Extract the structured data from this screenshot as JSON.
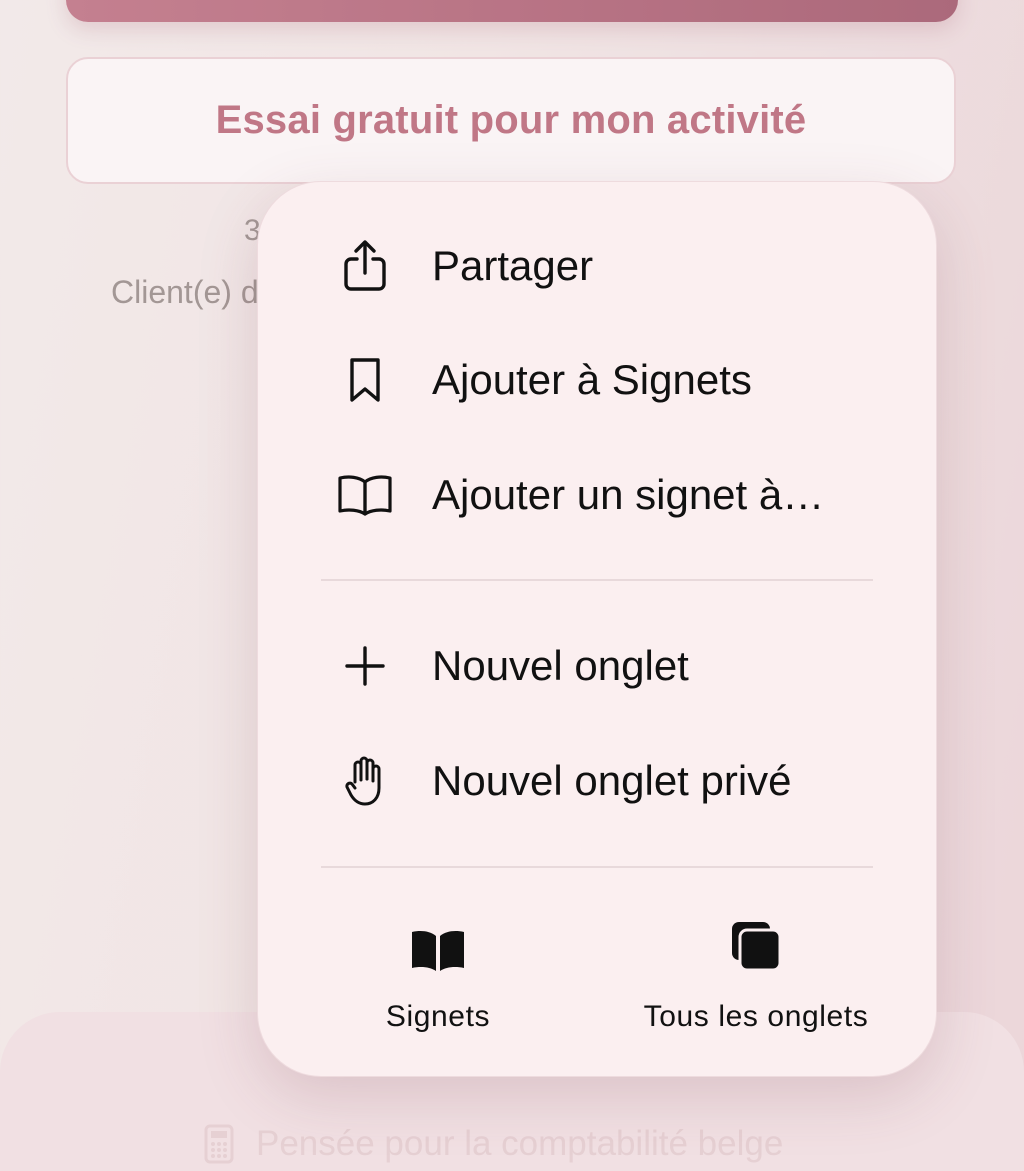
{
  "background": {
    "trial_button_label": "Essai gratuit pour mon activité",
    "partial_text_1": "3",
    "partial_text_2": "Client(e) d",
    "bottom_tagline": "Pensée pour la comptabilité belge",
    "bottom_tagline_icon": "calculator-icon",
    "accent_color": "#b25c6e"
  },
  "menu": {
    "items": [
      {
        "label": "Partager",
        "icon": "share-icon"
      },
      {
        "label": "Ajouter à Signets",
        "icon": "bookmark-icon"
      },
      {
        "label": "Ajouter un signet à…",
        "icon": "book-outline-icon"
      },
      {
        "label": "Nouvel onglet",
        "icon": "plus-icon"
      },
      {
        "label": "Nouvel onglet privé",
        "icon": "hand-icon"
      }
    ],
    "bottom_actions": [
      {
        "label": "Signets",
        "icon": "book-filled-icon"
      },
      {
        "label": "Tous les onglets",
        "icon": "tabs-icon"
      }
    ]
  }
}
